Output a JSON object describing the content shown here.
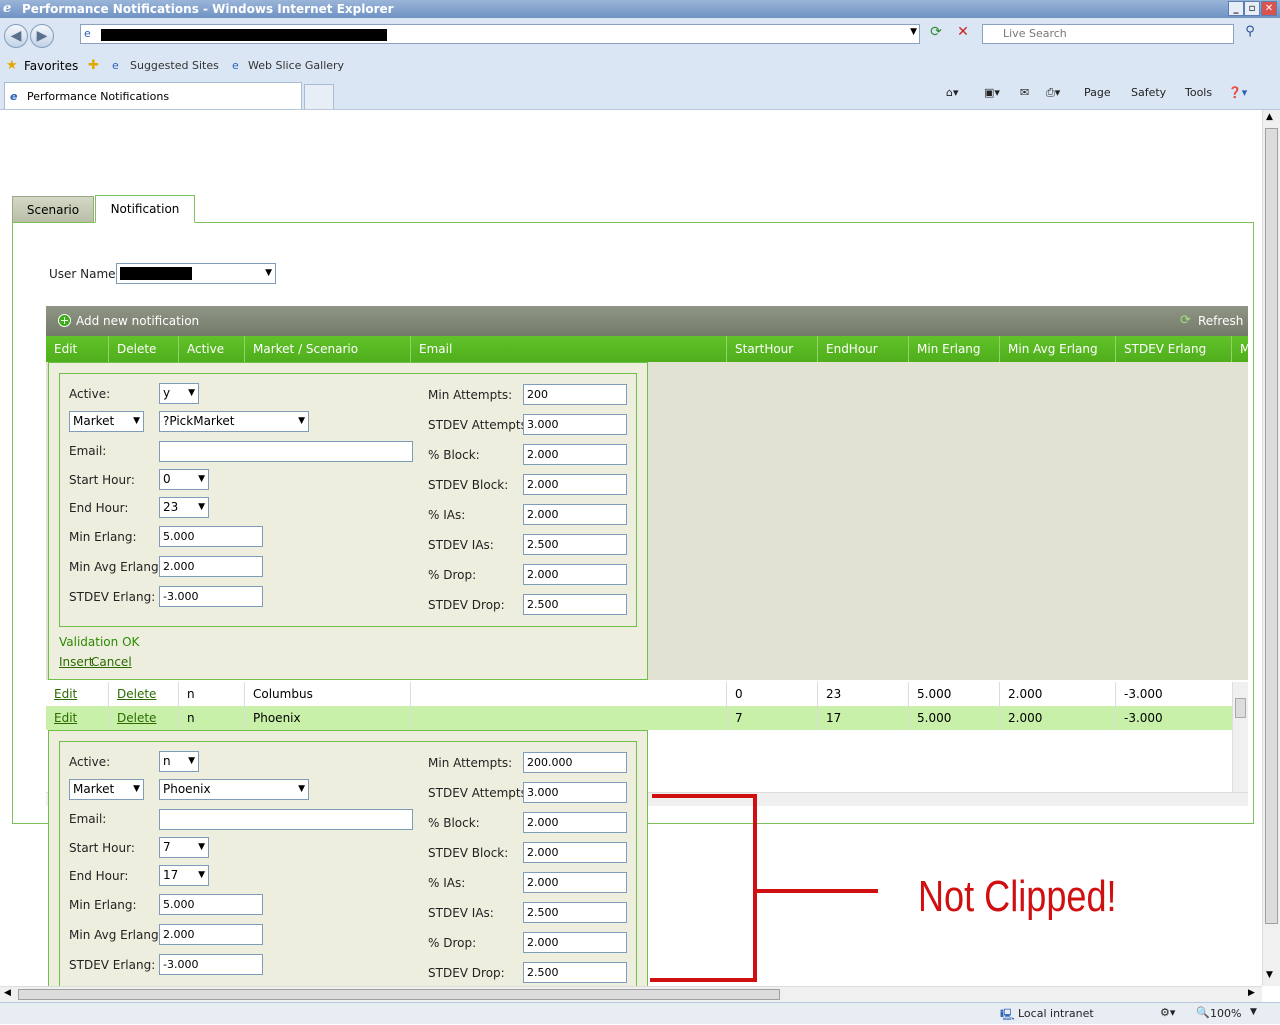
{
  "window": {
    "title": "Performance Notifications - Windows Internet Explorer",
    "min": "_",
    "max": "▫",
    "close": "✕"
  },
  "browser": {
    "search_placeholder": "Live Search",
    "favorites": "Favorites",
    "suggested_sites": "Suggested Sites",
    "web_slice_gallery": "Web Slice Gallery",
    "tab_title": "Performance Notifications",
    "page_menu": "Page",
    "safety_menu": "Safety",
    "tools_menu": "Tools"
  },
  "status": {
    "zone": "Local intranet",
    "zoom": "100%"
  },
  "page": {
    "tabs": [
      "Scenario",
      "Notification"
    ],
    "user_label": "User Name:",
    "add_new": "Add new notification",
    "refresh": "Refresh",
    "columns": [
      "Edit",
      "Delete",
      "Active",
      "Market / Scenario",
      "Email",
      "StartHour",
      "EndHour",
      "Min Erlang",
      "Min Avg Erlang",
      "STDEV Erlang",
      "M"
    ],
    "insert_form": {
      "active_label": "Active:",
      "active_value": "y",
      "type_value": "Market",
      "market_value": "?PickMarket",
      "email_label": "Email:",
      "email_value": "",
      "start_label": "Start Hour:",
      "start_value": "0",
      "end_label": "End Hour:",
      "end_value": "23",
      "min_erlang_label": "Min Erlang:",
      "min_erlang": "5.000",
      "min_avg_erlang_label": "Min Avg Erlang:",
      "min_avg_erlang": "2.000",
      "stdev_erlang_label": "STDEV Erlang:",
      "stdev_erlang": "-3.000",
      "min_attempts_label": "Min Attempts:",
      "min_attempts": "200",
      "stdev_attempts_label": "STDEV Attempts:",
      "stdev_attempts": "3.000",
      "block_label": "% Block:",
      "block": "2.000",
      "stdev_block_label": "STDEV Block:",
      "stdev_block": "2.000",
      "ias_label": "% IAs:",
      "ias": "2.000",
      "stdev_ias_label": "STDEV IAs:",
      "stdev_ias": "2.500",
      "drop_label": "% Drop:",
      "drop": "2.000",
      "stdev_drop_label": "STDEV Drop:",
      "stdev_drop": "2.500",
      "validation": "Validation OK",
      "insert": "Insert",
      "cancel": "Cancel"
    },
    "rows": [
      {
        "edit": "Edit",
        "delete": "Delete",
        "active": "n",
        "market": "Columbus",
        "start": "0",
        "end": "23",
        "min_erlang": "5.000",
        "min_avg": "2.000",
        "stdev": "-3.000"
      },
      {
        "edit": "Edit",
        "delete": "Delete",
        "active": "n",
        "market": "Phoenix",
        "start": "7",
        "end": "17",
        "min_erlang": "5.000",
        "min_avg": "2.000",
        "stdev": "-3.000"
      }
    ],
    "edit_form": {
      "active_label": "Active:",
      "active_value": "n",
      "type_value": "Market",
      "market_value": "Phoenix",
      "email_label": "Email:",
      "email_value": "",
      "start_label": "Start Hour:",
      "start_value": "7",
      "end_label": "End Hour:",
      "end_value": "17",
      "min_erlang_label": "Min Erlang:",
      "min_erlang": "5.000",
      "min_avg_erlang_label": "Min Avg Erlang:",
      "min_avg_erlang": "2.000",
      "stdev_erlang_label": "STDEV Erlang:",
      "stdev_erlang": "-3.000",
      "min_attempts_label": "Min Attempts:",
      "min_attempts": "200.000",
      "stdev_attempts_label": "STDEV Attempts:",
      "stdev_attempts": "3.000",
      "block_label": "% Block:",
      "block": "2.000",
      "stdev_block_label": "STDEV Block:",
      "stdev_block": "2.000",
      "ias_label": "% IAs:",
      "ias": "2.000",
      "stdev_ias_label": "STDEV IAs:",
      "stdev_ias": "2.500",
      "drop_label": "% Drop:",
      "drop": "2.000",
      "stdev_drop_label": "STDEV Drop:",
      "stdev_drop": "2.500"
    },
    "annotation": "Not Clipped!"
  }
}
